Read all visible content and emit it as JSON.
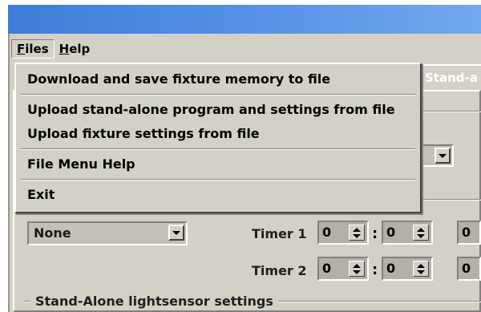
{
  "menubar": {
    "files": {
      "mnemonic": "F",
      "rest": "iles"
    },
    "help": {
      "mnemonic": "H",
      "rest": "elp"
    }
  },
  "tab_fragment": "Stand-a",
  "files_menu": [
    {
      "label": "Download and save fixture memory to file"
    },
    {
      "label": "Upload stand-alone program and settings from file"
    },
    {
      "label": "Upload fixture settings from file"
    },
    {
      "label": "File Menu Help"
    },
    {
      "label": "Exit"
    }
  ],
  "mode_select": {
    "value": "None"
  },
  "timer1": {
    "label": "Timer 1",
    "a": "0",
    "b": "0",
    "c": "0"
  },
  "timer2": {
    "label": "Timer 2",
    "a": "0",
    "b": "0",
    "c": "0"
  },
  "timer_separator": ":",
  "lightsensor_group": {
    "legend": "Stand-Alone lightsensor settings"
  }
}
